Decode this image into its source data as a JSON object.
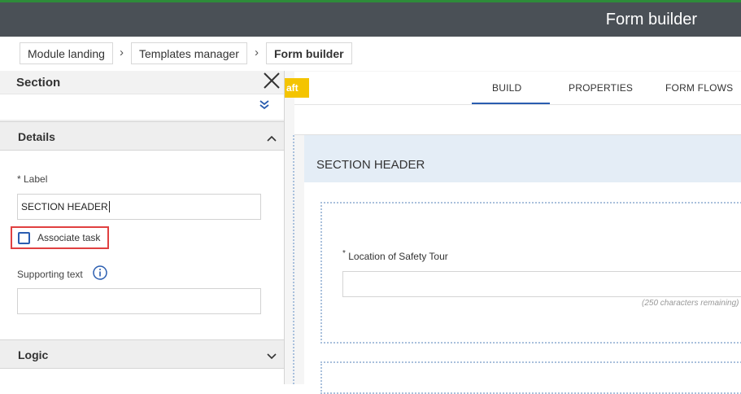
{
  "header": {
    "title": "Form builder"
  },
  "breadcrumb": [
    "Module landing",
    "Templates manager",
    "Form builder"
  ],
  "panel": {
    "title": "Section",
    "details_title": "Details",
    "label_caption": "* Label",
    "label_value": "SECTION HEADER",
    "associate_task": "Associate task",
    "supporting_text_caption": "Supporting text",
    "supporting_text_value": "",
    "logic_title": "Logic"
  },
  "status_badge": "aft",
  "tabs": {
    "build": "BUILD",
    "properties": "PROPERTIES",
    "form_flows": "FORM FLOWS"
  },
  "section": {
    "header": "SECTION HEADER",
    "question_label": "Location of Safety Tour",
    "required_mark": "*",
    "char_hint": "(250 characters remaining)"
  },
  "colors": {
    "accent": "#2a5db0",
    "draft": "#f4c400",
    "highlight": "#e04040",
    "titlebar": "#4a5056"
  }
}
